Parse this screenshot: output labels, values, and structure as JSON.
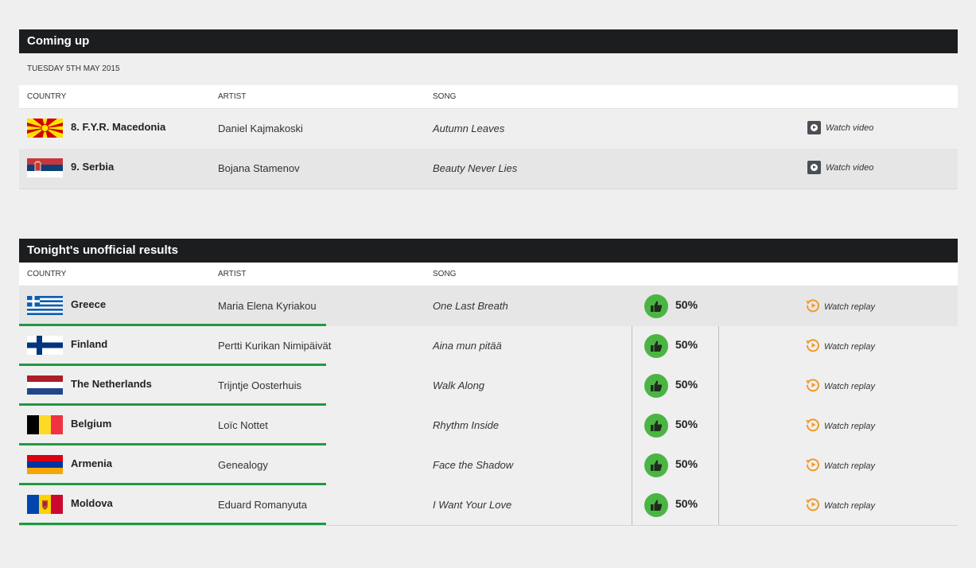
{
  "coming_up": {
    "title": "Coming up",
    "date": "TUESDAY 5TH MAY 2015",
    "headers": {
      "country": "COUNTRY",
      "artist": "ARTIST",
      "song": "SONG"
    },
    "rows": [
      {
        "country": "8. F.Y.R. Macedonia",
        "flag": "macedonia-flag",
        "artist": "Daniel Kajmakoski",
        "song": "Autumn Leaves",
        "action": "Watch video"
      },
      {
        "country": "9. Serbia",
        "flag": "serbia-flag",
        "artist": "Bojana Stamenov",
        "song": "Beauty Never Lies",
        "action": "Watch video"
      }
    ]
  },
  "results": {
    "title": "Tonight's unofficial results",
    "headers": {
      "country": "COUNTRY",
      "artist": "ARTIST",
      "song": "SONG"
    },
    "rows": [
      {
        "country": "Greece",
        "flag": "greece-flag",
        "artist": "Maria Elena Kyriakou",
        "song": "One Last Breath",
        "vote": "50%",
        "action": "Watch replay"
      },
      {
        "country": "Finland",
        "flag": "finland-flag",
        "artist": "Pertti Kurikan Nimipäivät",
        "song": "Aina mun pitää",
        "vote": "50%",
        "action": "Watch replay"
      },
      {
        "country": "The Netherlands",
        "flag": "netherlands-flag",
        "artist": "Trijntje Oosterhuis",
        "song": "Walk Along",
        "vote": "50%",
        "action": "Watch replay"
      },
      {
        "country": "Belgium",
        "flag": "belgium-flag",
        "artist": "Loïc Nottet",
        "song": "Rhythm Inside",
        "vote": "50%",
        "action": "Watch replay"
      },
      {
        "country": "Armenia",
        "flag": "armenia-flag",
        "artist": "Genealogy",
        "song": "Face the Shadow",
        "vote": "50%",
        "action": "Watch replay"
      },
      {
        "country": "Moldova",
        "flag": "moldova-flag",
        "artist": "Eduard Romanyuta",
        "song": "I Want Your Love",
        "vote": "50%",
        "action": "Watch replay"
      }
    ]
  },
  "colors": {
    "header_bar": "#1c1d1f",
    "accent_green": "#1f9a40",
    "thumb_green": "#4bb543",
    "replay_orange": "#f39a27",
    "play_box": "#4a4e55"
  },
  "icons": {
    "watch_video": "play-icon",
    "vote": "thumbs-up-icon",
    "watch_replay": "replay-icon"
  }
}
